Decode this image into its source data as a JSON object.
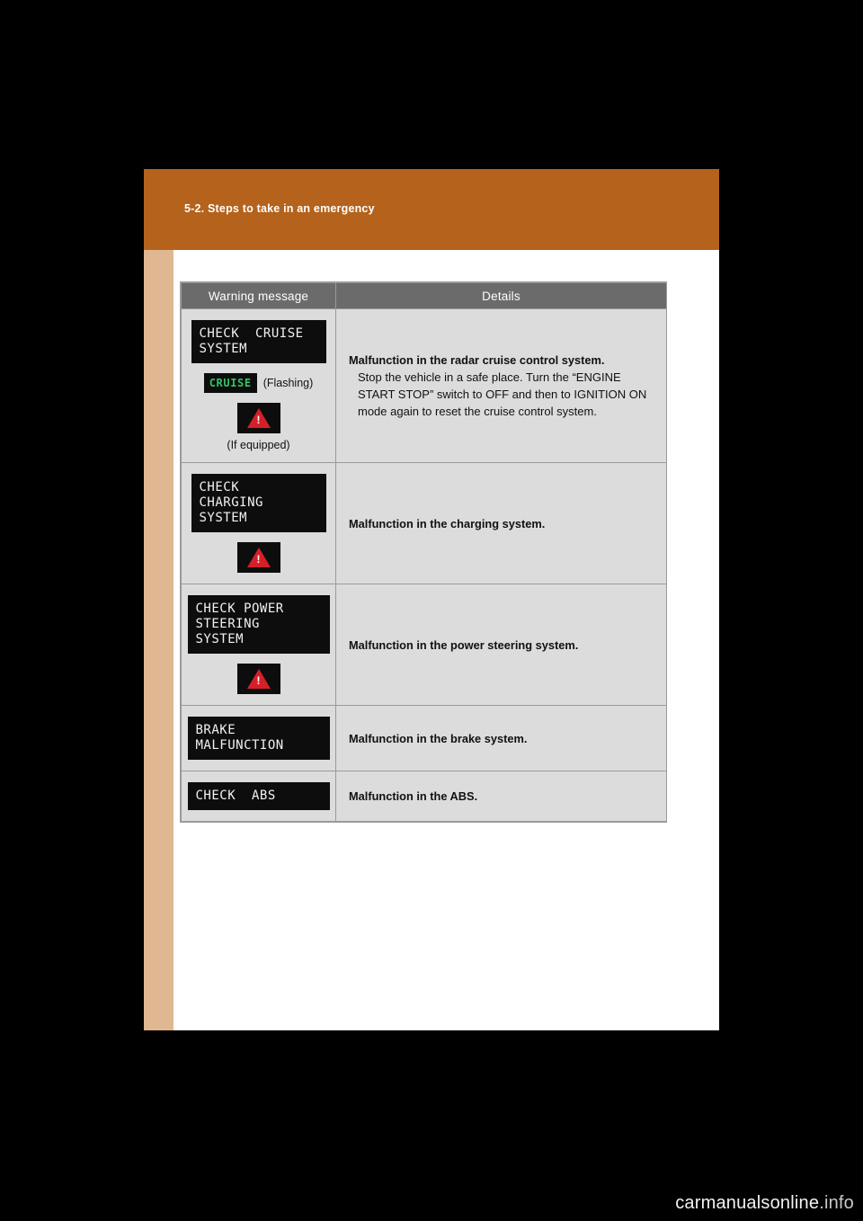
{
  "header": {
    "section": "5-2. Steps to take in an emergency"
  },
  "table": {
    "columns": [
      "Warning message",
      "Details"
    ],
    "rows": [
      {
        "message_lines": "CHECK  CRUISE\nSYSTEM",
        "cruise_badge": "CRUISE",
        "flashing_label": "(Flashing)",
        "if_equipped": "(If equipped)",
        "detail_title": "Malfunction in the radar cruise control system.",
        "detail_body": "Stop the vehicle in a safe place. Turn the “ENGINE START STOP” switch to OFF and then to IGNITION ON mode again to reset the cruise control system."
      },
      {
        "message_lines": "CHECK\nCHARGING\nSYSTEM",
        "detail_title": "Malfunction in the charging system.",
        "detail_body": ""
      },
      {
        "message_lines": "CHECK POWER\nSTEERING\nSYSTEM",
        "detail_title": "Malfunction in the power steering system.",
        "detail_body": ""
      },
      {
        "message_lines": "BRAKE\nMALFUNCTION",
        "detail_title": "Malfunction in the brake system.",
        "detail_body": ""
      },
      {
        "message_lines": "CHECK  ABS",
        "detail_title": "Malfunction in the ABS.",
        "detail_body": ""
      }
    ]
  },
  "watermark": {
    "main": "carmanuals",
    "suffix": "online",
    "tld": ".info"
  },
  "colors": {
    "header_band": "#b4621c",
    "side_tab": "#dfb790",
    "table_header": "#6b6b6b",
    "cell_bg": "#dcdcdc",
    "lcd_bg": "#0d0d0d",
    "cruise_green": "#35c463",
    "warning_red": "#d5202a"
  }
}
